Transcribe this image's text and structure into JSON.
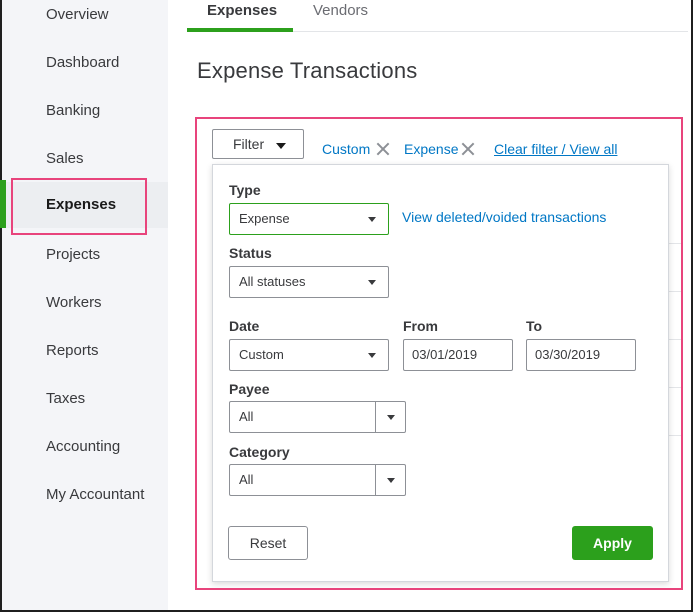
{
  "sidebar": {
    "items": [
      {
        "label": "Overview"
      },
      {
        "label": "Dashboard"
      },
      {
        "label": "Banking"
      },
      {
        "label": "Sales"
      },
      {
        "label": "Expenses",
        "active": true
      },
      {
        "label": "Projects"
      },
      {
        "label": "Workers"
      },
      {
        "label": "Reports"
      },
      {
        "label": "Taxes"
      },
      {
        "label": "Accounting"
      },
      {
        "label": "My Accountant"
      }
    ]
  },
  "tabs": [
    {
      "label": "Expenses",
      "active": true
    },
    {
      "label": "Vendors"
    }
  ],
  "page": {
    "title": "Expense Transactions"
  },
  "filter_bar": {
    "filter_button": "Filter",
    "chips": [
      {
        "label": "Custom"
      },
      {
        "label": "Expense"
      }
    ],
    "clear_link": "Clear filter / View all"
  },
  "filter_panel": {
    "type": {
      "label": "Type",
      "value": "Expense"
    },
    "deleted_link": "View deleted/voided transactions",
    "status": {
      "label": "Status",
      "value": "All statuses"
    },
    "date": {
      "label": "Date",
      "value": "Custom"
    },
    "from": {
      "label": "From",
      "value": "03/01/2019"
    },
    "to": {
      "label": "To",
      "value": "03/30/2019"
    },
    "payee": {
      "label": "Payee",
      "value": "All"
    },
    "category": {
      "label": "Category",
      "value": "All"
    },
    "reset_button": "Reset",
    "apply_button": "Apply"
  },
  "colors": {
    "accent_green": "#2ca01c",
    "link_blue": "#0077c5",
    "highlight_pink": "#e8447c"
  }
}
